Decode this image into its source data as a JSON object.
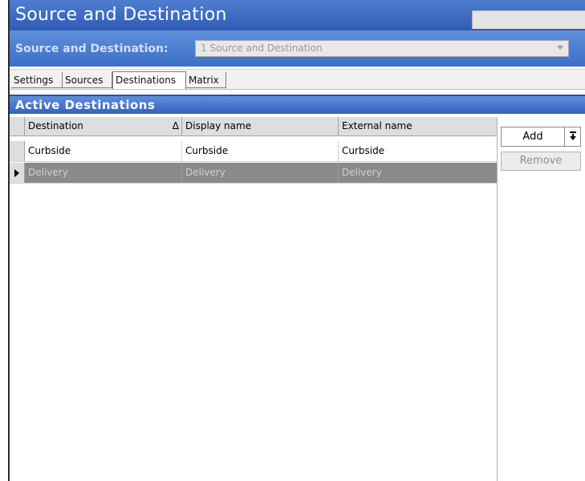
{
  "window": {
    "title": "Source and Destination"
  },
  "selector": {
    "label": "Source and Destination:",
    "value": "1 Source and Destination"
  },
  "tabs": [
    {
      "label": "Settings",
      "active": false
    },
    {
      "label": "Sources",
      "active": false
    },
    {
      "label": "Destinations",
      "active": true
    },
    {
      "label": "Matrix",
      "active": false
    }
  ],
  "section": {
    "title": "Active Destinations"
  },
  "grid": {
    "columns": [
      "Destination",
      "Display name",
      "External name"
    ],
    "sort_icon": "Δ",
    "rows": [
      {
        "destination": "Curbside",
        "display_name": "Curbside",
        "external_name": "Curbside",
        "selected": false
      },
      {
        "destination": "Delivery",
        "display_name": "Delivery",
        "external_name": "Delivery",
        "selected": true
      }
    ]
  },
  "buttons": {
    "add_label": "Add",
    "remove_label": "Remove"
  },
  "colors": {
    "titlebar": "#2e5cb4",
    "selected_row": "#8a8a8a"
  }
}
